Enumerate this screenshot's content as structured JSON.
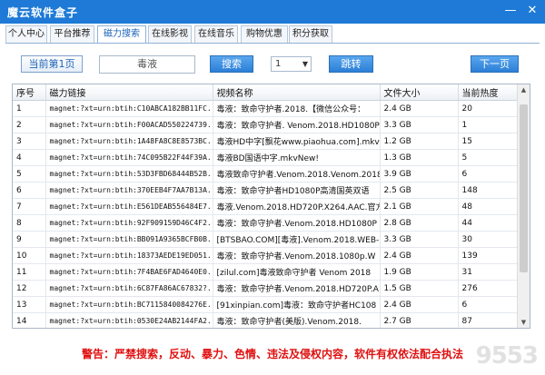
{
  "window": {
    "title": "魔云软件盒子",
    "min": "—",
    "close": "✕"
  },
  "tabs": [
    {
      "label": "个人中心"
    },
    {
      "label": "平台推荐"
    },
    {
      "label": "磁力搜索"
    },
    {
      "label": "在线影视"
    },
    {
      "label": "在线音乐"
    },
    {
      "label": "购物优惠"
    },
    {
      "label": "积分获取"
    }
  ],
  "toolbar": {
    "page_label": "当前第1页",
    "search_value": "毒液",
    "search_button": "搜索",
    "page_select": "1",
    "jump_button": "跳转",
    "next_button": "下一页"
  },
  "grid": {
    "headers": [
      "序号",
      "磁力链接",
      "视频名称",
      "文件大小",
      "当前热度"
    ],
    "rows": [
      [
        "1",
        "magnet:?xt=urn:btih:C10ABCA182BB11FC...",
        "毒液：致命守护者.2018.【微信公众号：",
        "2.4 GB",
        "20"
      ],
      [
        "2",
        "magnet:?xt=urn:btih:F00ACAD550224739...",
        "毒液：致命守护者. Venom.2018.HD1080P",
        "3.3 GB",
        "1"
      ],
      [
        "3",
        "magnet:?xt=urn:btih:1A48FA8C8E8573BC...",
        "毒液HD中字[飘花www.piaohua.com].mkvNew!",
        "1.2 GB",
        "15"
      ],
      [
        "4",
        "magnet:?xt=urn:btih:74C095B22F44F39A...",
        "毒液BD国语中字.mkvNew!",
        "1.3 GB",
        "5"
      ],
      [
        "5",
        "magnet:?xt=urn:btih:53D3FBD68444B52B...",
        "毒液致命守护者.Venom.2018.Venom.2018",
        "3.9 GB",
        "6"
      ],
      [
        "6",
        "magnet:?xt=urn:btih:370EEB4F7AA7B13A...",
        "毒液：致命守护者HD1080P高清国英双语",
        "2.5 GB",
        "148"
      ],
      [
        "7",
        "magnet:?xt=urn:btih:E561DEAB556484E7...",
        "毒液.Venom.2018.HD720P.X264.AAC.官方",
        "2.1 GB",
        "48"
      ],
      [
        "8",
        "magnet:?xt=urn:btih:92F909159D46C4F2...",
        "毒液：致命守护者.Venom.2018.HD1080P",
        "2.8 GB",
        "44"
      ],
      [
        "9",
        "magnet:?xt=urn:btih:BB091A9365BCFB0B...",
        "[BTSBAO.COM][毒液].Venom.2018.WEB-DL",
        "3.3 GB",
        "30"
      ],
      [
        "10",
        "magnet:?xt=urn:btih:18373AEDE19ED051...",
        "毒液：致命守护者.Venom.2018.1080p.W",
        "2.4 GB",
        "139"
      ],
      [
        "11",
        "magnet:?xt=urn:btih:7F4BAE6FAD4640E0...",
        "[zilul.com]毒液致命守护者 Venom 2018",
        "1.9 GB",
        "31"
      ],
      [
        "12",
        "magnet:?xt=urn:btih:6C87FA86AC67832?...",
        "毒液：致命守护者.Venom.2018.HD720P.A",
        "1.5 GB",
        "276"
      ],
      [
        "13",
        "magnet:?xt=urn:btih:BC7115840084276E...",
        "[91xinpian.com]毒液：致命守护者HC108",
        "2.4 GB",
        "6"
      ],
      [
        "14",
        "magnet:?xt=urn:btih:0530E24AB2144FA2...",
        "毒液：致命守护者(美版).Venom.2018.",
        "2.7 GB",
        "87"
      ]
    ]
  },
  "footer": {
    "warning": "警告：严禁搜索，反动、暴力、色情、违法及侵权内容，软件有权依法配合执法",
    "watermark": "9553"
  }
}
